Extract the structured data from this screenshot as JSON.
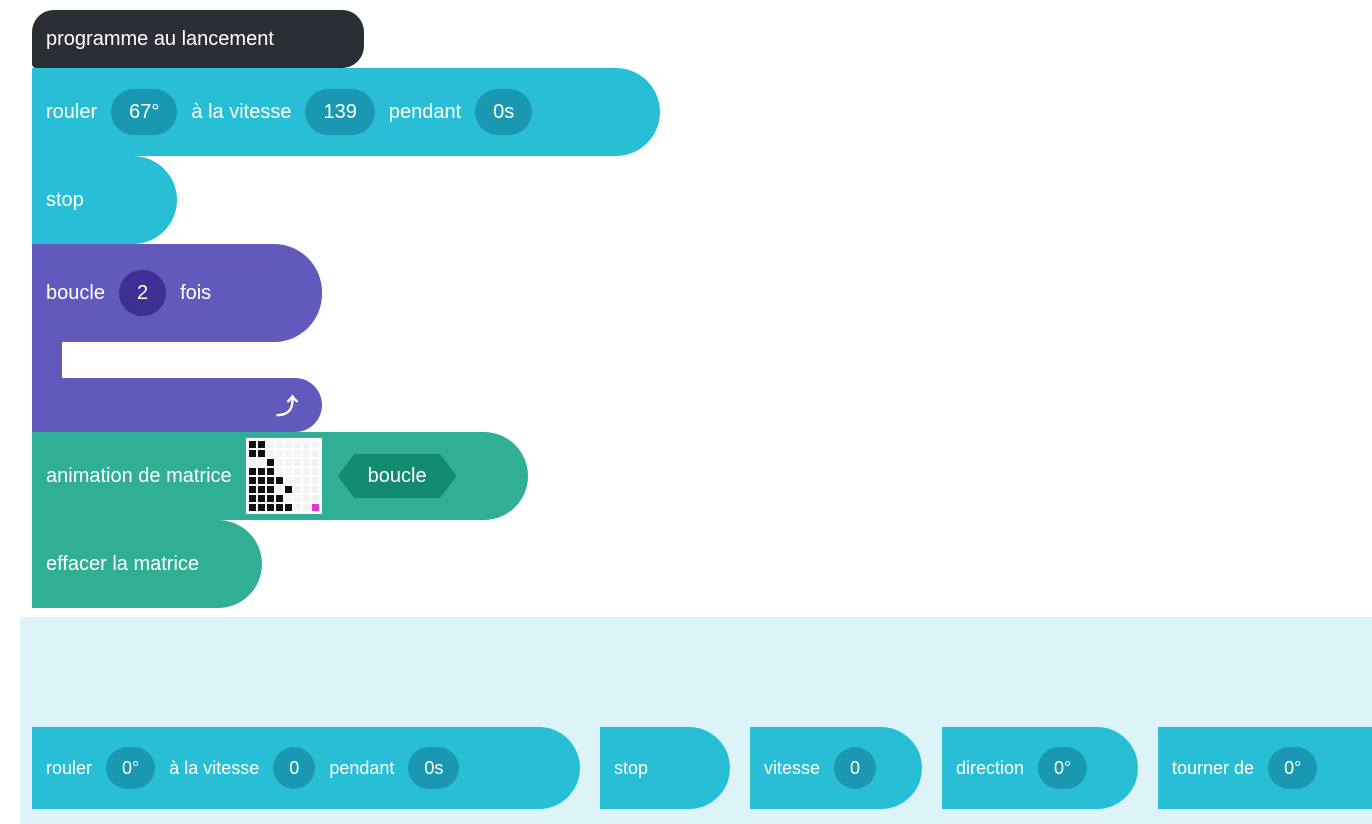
{
  "workspace": {
    "hat_block": {
      "label": "programme au lancement"
    },
    "roll_block": {
      "roll": "rouler",
      "angle": "67°",
      "speed_label": "à la vitesse",
      "speed": "139",
      "during": "pendant",
      "duration": "0s"
    },
    "stop_block": {
      "label": "stop"
    },
    "loop_block": {
      "prefix": "boucle",
      "count": "2",
      "suffix": "fois",
      "arrow_icon": "loop-arrow-icon"
    },
    "matrix_anim_block": {
      "label": "animation de matrice",
      "mode": "boucle",
      "matrix_rows": [
        "00111111",
        "00111111",
        "11011111",
        "00011111",
        "00001111",
        "00010111",
        "00001111",
        "00000112"
      ]
    },
    "clear_matrix_block": {
      "label": "effacer la matrice"
    }
  },
  "palette": {
    "roll_block": {
      "roll": "rouler",
      "angle": "0°",
      "speed_label": "à la vitesse",
      "speed": "0",
      "during": "pendant",
      "duration": "0s"
    },
    "stop_block": {
      "label": "stop"
    },
    "speed_block": {
      "label": "vitesse",
      "value": "0"
    },
    "direction_block": {
      "label": "direction",
      "value": "0°"
    },
    "turn_block": {
      "label": "tourner de",
      "value": "0°"
    }
  },
  "colors": {
    "motion": "#28bfd6",
    "control": "#6259bd",
    "display": "#31ae96",
    "event": "#2b2e34",
    "palette_bg": "#dcf3f8"
  }
}
